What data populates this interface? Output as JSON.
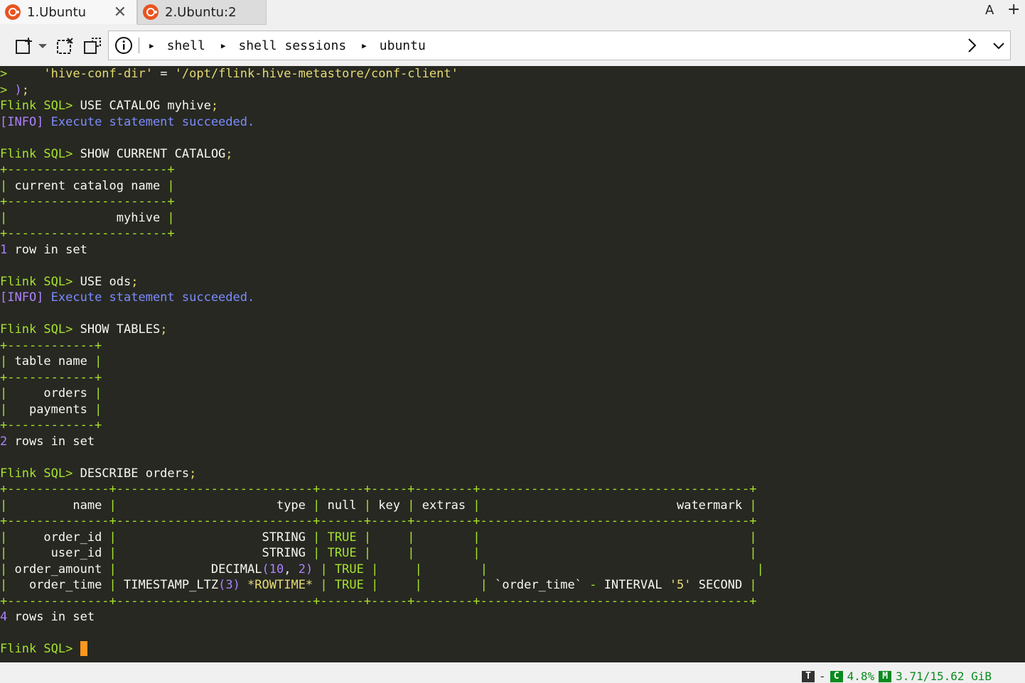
{
  "tabs": [
    {
      "label": "1.Ubuntu",
      "active": true
    },
    {
      "label": "2.Ubuntu:2",
      "active": false
    }
  ],
  "tabbar": {
    "font_button": "A",
    "add_button": "+"
  },
  "breadcrumbs": [
    "shell",
    "shell sessions",
    "ubuntu"
  ],
  "terminal": {
    "lines": [
      [
        {
          "t": ">     ",
          "c": "g"
        },
        {
          "t": "'hive-conf-dir'",
          "c": "y"
        },
        {
          "t": " = ",
          "c": "w"
        },
        {
          "t": "'/opt/flink-hive-metastore/conf-client'",
          "c": "y"
        }
      ],
      [
        {
          "t": "> ",
          "c": "g"
        },
        {
          "t": ")",
          "c": "p"
        },
        {
          "t": ";",
          "c": "y"
        }
      ],
      [
        {
          "t": "Flink SQL> ",
          "c": "g"
        },
        {
          "t": "USE CATALOG myhive",
          "c": "w"
        },
        {
          "t": ";",
          "c": "y"
        }
      ],
      [
        {
          "t": "[INFO] ",
          "c": "p"
        },
        {
          "t": "Execute statement succeeded.",
          "c": "b"
        }
      ],
      [],
      [
        {
          "t": "Flink SQL> ",
          "c": "g"
        },
        {
          "t": "SHOW CURRENT CATALOG",
          "c": "w"
        },
        {
          "t": ";",
          "c": "y"
        }
      ],
      [
        {
          "t": "+----------------------+",
          "c": "g"
        }
      ],
      [
        {
          "t": "| ",
          "c": "g"
        },
        {
          "t": "current catalog name",
          "c": "w"
        },
        {
          "t": " |",
          "c": "g"
        }
      ],
      [
        {
          "t": "+----------------------+",
          "c": "g"
        }
      ],
      [
        {
          "t": "|",
          "c": "g"
        },
        {
          "t": "               myhive",
          "c": "w"
        },
        {
          "t": " |",
          "c": "g"
        }
      ],
      [
        {
          "t": "+----------------------+",
          "c": "g"
        }
      ],
      [
        {
          "t": "1",
          "c": "p"
        },
        {
          "t": " row in set",
          "c": "w"
        }
      ],
      [],
      [
        {
          "t": "Flink SQL> ",
          "c": "g"
        },
        {
          "t": "USE ods",
          "c": "w"
        },
        {
          "t": ";",
          "c": "y"
        }
      ],
      [
        {
          "t": "[INFO] ",
          "c": "p"
        },
        {
          "t": "Execute statement succeeded.",
          "c": "b"
        }
      ],
      [],
      [
        {
          "t": "Flink SQL> ",
          "c": "g"
        },
        {
          "t": "SHOW TABLES",
          "c": "w"
        },
        {
          "t": ";",
          "c": "y"
        }
      ],
      [
        {
          "t": "+------------+",
          "c": "g"
        }
      ],
      [
        {
          "t": "| ",
          "c": "g"
        },
        {
          "t": "table name",
          "c": "w"
        },
        {
          "t": " |",
          "c": "g"
        }
      ],
      [
        {
          "t": "+------------+",
          "c": "g"
        }
      ],
      [
        {
          "t": "|",
          "c": "g"
        },
        {
          "t": "     orders",
          "c": "w"
        },
        {
          "t": " |",
          "c": "g"
        }
      ],
      [
        {
          "t": "|",
          "c": "g"
        },
        {
          "t": "   payments",
          "c": "w"
        },
        {
          "t": " |",
          "c": "g"
        }
      ],
      [
        {
          "t": "+------------+",
          "c": "g"
        }
      ],
      [
        {
          "t": "2",
          "c": "p"
        },
        {
          "t": " rows in set",
          "c": "w"
        }
      ],
      [],
      [
        {
          "t": "Flink SQL> ",
          "c": "g"
        },
        {
          "t": "DESCRIBE orders",
          "c": "w"
        },
        {
          "t": ";",
          "c": "y"
        }
      ],
      [
        {
          "t": "+--------------+---------------------------+------+-----+--------+-------------------------------------+",
          "c": "g"
        }
      ],
      [
        {
          "t": "|",
          "c": "g"
        },
        {
          "t": "         name ",
          "c": "w"
        },
        {
          "t": "|",
          "c": "g"
        },
        {
          "t": "                      type ",
          "c": "w"
        },
        {
          "t": "|",
          "c": "g"
        },
        {
          "t": " null ",
          "c": "w"
        },
        {
          "t": "|",
          "c": "g"
        },
        {
          "t": " key ",
          "c": "w"
        },
        {
          "t": "|",
          "c": "g"
        },
        {
          "t": " extras ",
          "c": "w"
        },
        {
          "t": "|",
          "c": "g"
        },
        {
          "t": "                           watermark ",
          "c": "w"
        },
        {
          "t": "|",
          "c": "g"
        }
      ],
      [
        {
          "t": "+--------------+---------------------------+------+-----+--------+-------------------------------------+",
          "c": "g"
        }
      ],
      [
        {
          "t": "|",
          "c": "g"
        },
        {
          "t": "     order_id ",
          "c": "w"
        },
        {
          "t": "|",
          "c": "g"
        },
        {
          "t": "                    STRING ",
          "c": "w"
        },
        {
          "t": "|",
          "c": "g"
        },
        {
          "t": " TRUE ",
          "c": "g"
        },
        {
          "t": "|",
          "c": "g"
        },
        {
          "t": "     ",
          "c": "w"
        },
        {
          "t": "|",
          "c": "g"
        },
        {
          "t": "        ",
          "c": "w"
        },
        {
          "t": "|",
          "c": "g"
        },
        {
          "t": "                                     ",
          "c": "w"
        },
        {
          "t": "|",
          "c": "g"
        }
      ],
      [
        {
          "t": "|",
          "c": "g"
        },
        {
          "t": "      user_id ",
          "c": "w"
        },
        {
          "t": "|",
          "c": "g"
        },
        {
          "t": "                    STRING ",
          "c": "w"
        },
        {
          "t": "|",
          "c": "g"
        },
        {
          "t": " TRUE ",
          "c": "g"
        },
        {
          "t": "|",
          "c": "g"
        },
        {
          "t": "     ",
          "c": "w"
        },
        {
          "t": "|",
          "c": "g"
        },
        {
          "t": "        ",
          "c": "w"
        },
        {
          "t": "|",
          "c": "g"
        },
        {
          "t": "                                     ",
          "c": "w"
        },
        {
          "t": "|",
          "c": "g"
        }
      ],
      [
        {
          "t": "|",
          "c": "g"
        },
        {
          "t": " order_amount ",
          "c": "w"
        },
        {
          "t": "|",
          "c": "g"
        },
        {
          "t": "             DECIMAL",
          "c": "w"
        },
        {
          "t": "(",
          "c": "p"
        },
        {
          "t": "10",
          "c": "p"
        },
        {
          "t": ", ",
          "c": "w"
        },
        {
          "t": "2",
          "c": "p"
        },
        {
          "t": ") ",
          "c": "p"
        },
        {
          "t": "|",
          "c": "g"
        },
        {
          "t": " TRUE ",
          "c": "g"
        },
        {
          "t": "|",
          "c": "g"
        },
        {
          "t": "     ",
          "c": "w"
        },
        {
          "t": "|",
          "c": "g"
        },
        {
          "t": "        ",
          "c": "w"
        },
        {
          "t": "|",
          "c": "g"
        },
        {
          "t": "                                     ",
          "c": "w"
        },
        {
          "t": "|",
          "c": "g"
        }
      ],
      [
        {
          "t": "|",
          "c": "g"
        },
        {
          "t": "   order_time ",
          "c": "w"
        },
        {
          "t": "|",
          "c": "g"
        },
        {
          "t": " TIMESTAMP_LTZ",
          "c": "w"
        },
        {
          "t": "(3)",
          "c": "p"
        },
        {
          "t": " *ROWTIME* ",
          "c": "y"
        },
        {
          "t": "|",
          "c": "g"
        },
        {
          "t": " TRUE ",
          "c": "g"
        },
        {
          "t": "|",
          "c": "g"
        },
        {
          "t": "     ",
          "c": "w"
        },
        {
          "t": "|",
          "c": "g"
        },
        {
          "t": "        ",
          "c": "w"
        },
        {
          "t": "|",
          "c": "g"
        },
        {
          "t": " `order_time` ",
          "c": "w"
        },
        {
          "t": "-",
          "c": "g"
        },
        {
          "t": " INTERVAL ",
          "c": "w"
        },
        {
          "t": "'5'",
          "c": "y"
        },
        {
          "t": " SECOND ",
          "c": "w"
        },
        {
          "t": "|",
          "c": "g"
        }
      ],
      [
        {
          "t": "+--------------+---------------------------+------+-----+--------+-------------------------------------+",
          "c": "g"
        }
      ],
      [
        {
          "t": "4",
          "c": "p"
        },
        {
          "t": " rows in set",
          "c": "w"
        }
      ],
      [],
      [
        {
          "t": "Flink SQL> ",
          "c": "g"
        }
      ]
    ]
  },
  "statusbar": {
    "t_badge": "T",
    "dash": "-",
    "c_badge": "C",
    "cpu": "4.8%",
    "m_badge": "M",
    "mem": "3.71/15.62 GiB"
  },
  "colors": {
    "terminal_bg": "#272822",
    "prompt_green": "#a6e22e",
    "string_yellow": "#e6db74",
    "number_purple": "#ae81ff",
    "info_blue": "#7b8cff",
    "cursor_orange": "#fd971f"
  }
}
